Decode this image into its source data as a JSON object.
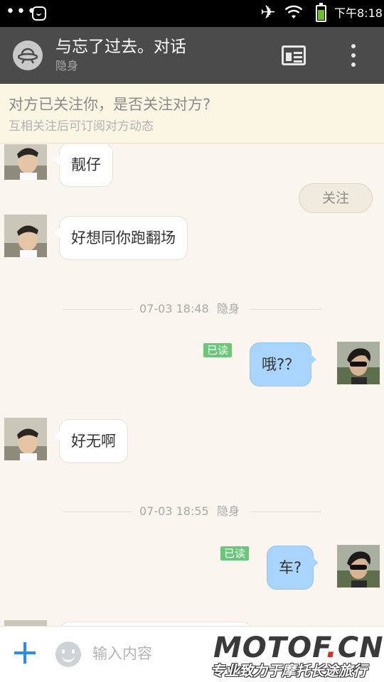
{
  "status_bar": {
    "notification_dots": "•••",
    "time": "下午8:18",
    "icons": [
      "notification-dots-icon",
      "app-icon",
      "airplane-icon",
      "wifi-icon",
      "battery-charging-icon"
    ]
  },
  "header": {
    "title": "与忘了过去。对话",
    "subtitle": "隐身",
    "icons": [
      "contact-avatar-icon",
      "profile-card-icon",
      "more-vertical-icon"
    ]
  },
  "follow_banner": {
    "question": "对方已关注你，是否关注对方?",
    "hint": "互相关注后可订阅对方动态",
    "follow_button": "关注"
  },
  "messages": [
    {
      "type": "incoming",
      "text": "靓仔"
    },
    {
      "type": "incoming",
      "text": "好想同你跑翻场"
    },
    {
      "type": "time",
      "time": "07-03 18:48",
      "status": "隐身"
    },
    {
      "type": "outgoing",
      "text": "哦?？",
      "read": "已读"
    },
    {
      "type": "incoming",
      "text": "好无啊"
    },
    {
      "type": "time",
      "time": "07-03 18:55",
      "status": "隐身"
    },
    {
      "type": "outgoing",
      "text": "车?",
      "read": "已读"
    }
  ],
  "input_bar": {
    "placeholder": "输入内容",
    "icons": [
      "plus-icon",
      "emoji-icon"
    ]
  },
  "watermark": {
    "brand_prefix": "MOTOF",
    "brand_dot": ".",
    "brand_suffix": "CN",
    "slogan": "专业致力于摩托长途旅行"
  },
  "colors": {
    "status_bar": "#000000",
    "title_bar": "#4b4b4b",
    "banner_bg": "#fbf6e4",
    "chat_bg": "#faf6ef",
    "outgoing_bubble": "#a9d4fb",
    "incoming_bubble": "#ffffff",
    "read_badge": "#6cc67a",
    "accent": "#2a8ee0"
  }
}
